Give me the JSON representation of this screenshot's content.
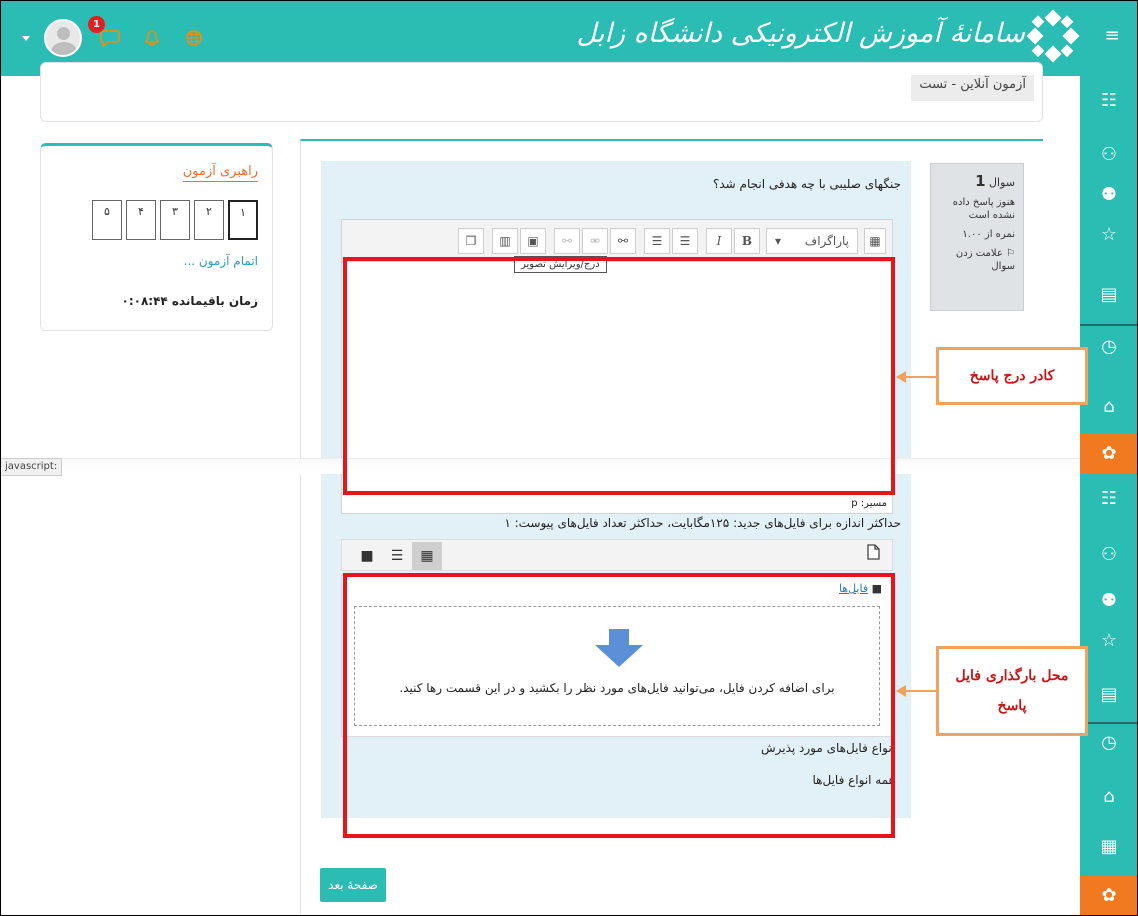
{
  "header": {
    "brand_text": "سامانۀ آموزش الکترونیکی دانشگاه زابل",
    "notification_count": "1",
    "icons": [
      "menu-icon",
      "avatar",
      "chat-icon",
      "bell-icon",
      "globe-icon"
    ],
    "accent_color": "#2bbcb3"
  },
  "breadcrumb": {
    "current": "آزمون آنلاین - تست"
  },
  "quiz_nav": {
    "title": "راهبری آزمون",
    "questions": [
      "۱",
      "۲",
      "۳",
      "۴",
      "۵"
    ],
    "current_index": 0,
    "finish_link": "اتمام آزمون ...",
    "time_left": "زمان باقیمانده ۰:۰۸:۴۴"
  },
  "question_info": {
    "label": "سوال",
    "number": "1",
    "state": "هنوز پاسخ داده نشده است",
    "mark": "نمره از ۱.۰۰",
    "flag": "علامت زدن سوال"
  },
  "question": {
    "text": "جنگهای صلیبی با چه هدفی انجام شد؟"
  },
  "editor": {
    "paragraph_select": "پاراگراف",
    "tooltip": "درج/ویرایش تصویر",
    "path": "مسیر: p"
  },
  "file_upload": {
    "max_size_text": "حداکثر اندازه برای فایل‌های جدید: ۱۲۵مگابایت، حداکثر تعداد فایل‌های پیوست: ۱",
    "folder_label": "فایل‌ها",
    "drop_text": "برای اضافه کردن فایل، می‌توانید فایل‌های مورد نظر را بکشید و در این قسمت رها کنید.",
    "accepted_label": "انواع فایل‌های مورد پذیرش",
    "accepted_value": "همه انواع فایل‌ها"
  },
  "callouts": {
    "answer_box": "کادر درج پاسخ",
    "upload_box": "محل بارگذاری فایل پاسخ"
  },
  "status_tip": "javascript:",
  "next_button": "صفحهٔ بعد"
}
